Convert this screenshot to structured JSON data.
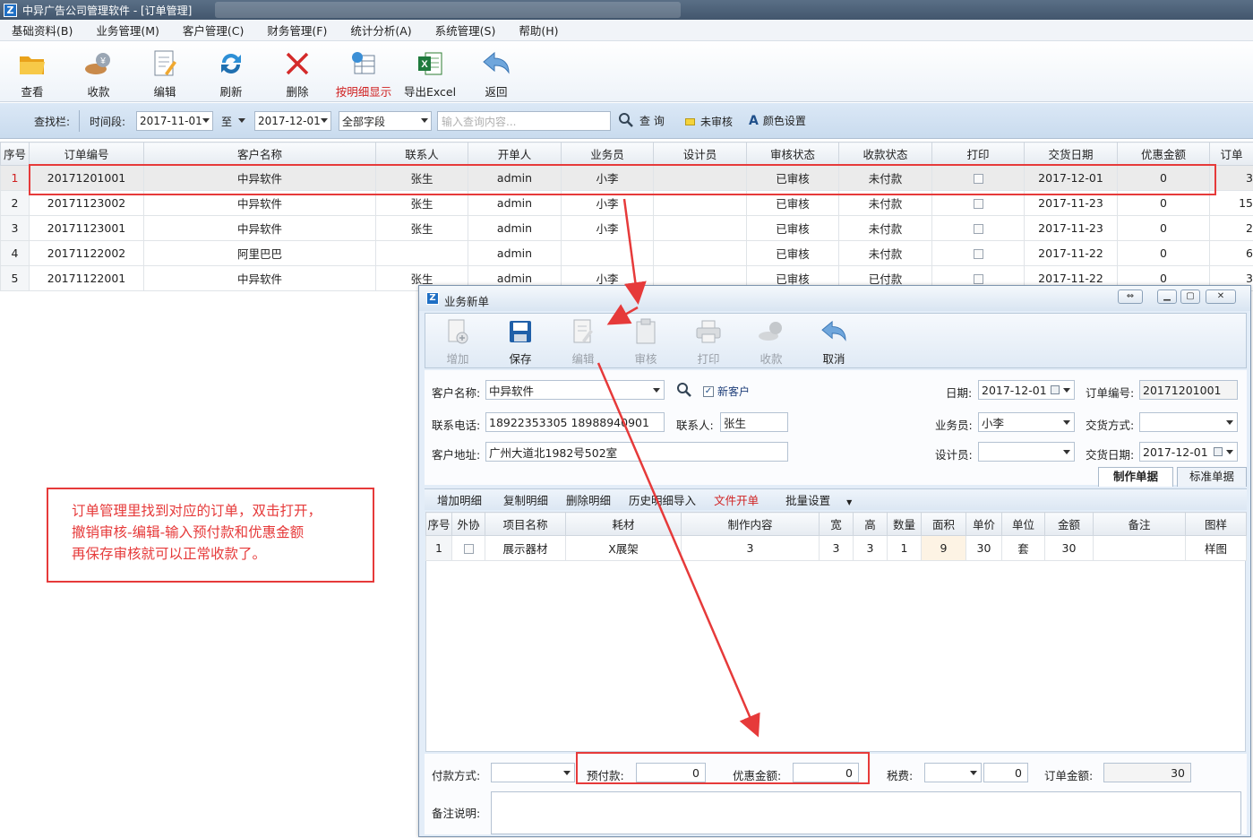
{
  "window": {
    "title": "中异广告公司管理软件 - [订单管理]",
    "icon_letter": "Z"
  },
  "menu": [
    "基础资料(B)",
    "业务管理(M)",
    "客户管理(C)",
    "财务管理(F)",
    "统计分析(A)",
    "系统管理(S)",
    "帮助(H)"
  ],
  "toolbar": {
    "view": "查看",
    "collect": "收款",
    "edit": "编辑",
    "refresh": "刷新",
    "delete": "删除",
    "detail_display": "按明细显示",
    "export_excel": "导出Excel",
    "back": "返回"
  },
  "search": {
    "label": "查找栏:",
    "time_label": "时间段:",
    "date_from": "2017-11-01",
    "to_label": "至",
    "date_to": "2017-12-01",
    "field": "全部字段",
    "placeholder": "输入查询内容...",
    "query": "查 询",
    "unaudited": "未审核",
    "color_settings": "颜色设置"
  },
  "orders": {
    "columns": [
      "序号",
      "订单编号",
      "客户名称",
      "联系人",
      "开单人",
      "业务员",
      "设计员",
      "审核状态",
      "收款状态",
      "打印",
      "交货日期",
      "优惠金额",
      "订单"
    ],
    "rows": [
      {
        "idx": "1",
        "order_no": "20171201001",
        "customer": "中异软件",
        "contact": "张生",
        "creator": "admin",
        "salesman": "小李",
        "designer": "",
        "audit": "已审核",
        "payment": "未付款",
        "delivery": "2017-12-01",
        "discount": "0",
        "amount": "3"
      },
      {
        "idx": "2",
        "order_no": "20171123002",
        "customer": "中异软件",
        "contact": "张生",
        "creator": "admin",
        "salesman": "小李",
        "designer": "",
        "audit": "已审核",
        "payment": "未付款",
        "delivery": "2017-11-23",
        "discount": "0",
        "amount": "15"
      },
      {
        "idx": "3",
        "order_no": "20171123001",
        "customer": "中异软件",
        "contact": "张生",
        "creator": "admin",
        "salesman": "小李",
        "designer": "",
        "audit": "已审核",
        "payment": "未付款",
        "delivery": "2017-11-23",
        "discount": "0",
        "amount": "2"
      },
      {
        "idx": "4",
        "order_no": "20171122002",
        "customer": "阿里巴巴",
        "contact": "",
        "creator": "admin",
        "salesman": "",
        "designer": "",
        "audit": "已审核",
        "payment": "未付款",
        "delivery": "2017-11-22",
        "discount": "0",
        "amount": "6"
      },
      {
        "idx": "5",
        "order_no": "20171122001",
        "customer": "中异软件",
        "contact": "张生",
        "creator": "admin",
        "salesman": "小李",
        "designer": "",
        "audit": "已审核",
        "payment": "已付款",
        "delivery": "2017-11-22",
        "discount": "0",
        "amount": "3"
      }
    ]
  },
  "note": {
    "line1": "订单管理里找到对应的订单，双击打开，",
    "line2": "撤销审核-编辑-输入预付款和优惠金额",
    "line3": "再保存审核就可以正常收款了。"
  },
  "dialog": {
    "title": "业务新单",
    "buttons": {
      "add": "增加",
      "save": "保存",
      "edit": "编辑",
      "audit": "审核",
      "print": "打印",
      "collect": "收款",
      "cancel": "取消"
    },
    "form": {
      "customer_label": "客户名称:",
      "customer": "中异软件",
      "new_customer": "新客户",
      "date_label": "日期:",
      "date": "2017-12-01",
      "order_no_label": "订单编号:",
      "order_no": "20171201001",
      "phone_label": "联系电话:",
      "phone": "18922353305 18988940901",
      "contact_label": "联系人:",
      "contact": "张生",
      "salesman_label": "业务员:",
      "salesman": "小李",
      "trade_label": "交货方式:",
      "trade": "",
      "address_label": "客户地址:",
      "address": "广州大道北1982号502室",
      "designer_label": "设计员:",
      "designer": "",
      "delivery_label": "交货日期:",
      "delivery": "2017-12-01"
    },
    "tabs": {
      "make": "制作单据",
      "standard": "标准单据"
    },
    "subbar": {
      "add_detail": "增加明细",
      "copy_detail": "复制明细",
      "delete_detail": "删除明细",
      "history_import": "历史明细导入",
      "file_order": "文件开单",
      "batch": "批量设置"
    },
    "items": {
      "columns": [
        "序号",
        "外协",
        "项目名称",
        "耗材",
        "制作内容",
        "宽",
        "高",
        "数量",
        "面积",
        "单价",
        "单位",
        "金额",
        "备注",
        "图样"
      ],
      "rows": [
        {
          "idx": "1",
          "name": "展示器材",
          "material": "X展架",
          "content": "3",
          "w": "3",
          "h": "3",
          "qty": "1",
          "area": "9",
          "price": "30",
          "unit": "套",
          "amount": "30",
          "remark": "",
          "sample": "样图"
        }
      ]
    },
    "bottom": {
      "pay_method_label": "付款方式:",
      "pay_method": "",
      "prepay_label": "预付款:",
      "prepay": "0",
      "discount_label": "优惠金额:",
      "discount": "0",
      "tax_label": "税费:",
      "tax_type": "",
      "tax": "0",
      "amount_label": "订单金额:",
      "amount": "30",
      "remark_label": "备注说明:"
    }
  },
  "colors": {
    "accent_red": "#e63a3a",
    "title_bar": "#4b6079",
    "search_bar": "#d3e3f4"
  }
}
